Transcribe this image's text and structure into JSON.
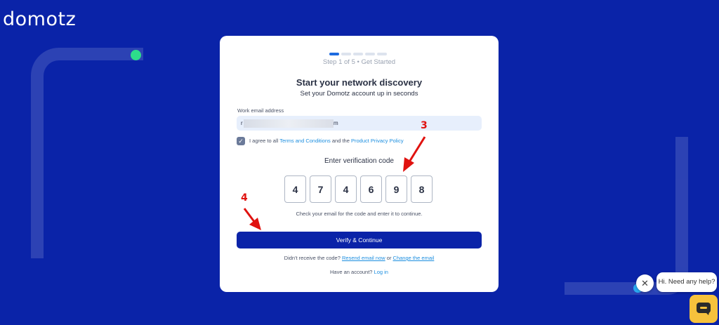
{
  "brand": {
    "logo_text": "domotz"
  },
  "colors": {
    "background": "#0a23a8",
    "primary_button": "#0a23a8",
    "link": "#1d8fe0",
    "annotation": "#e0120f",
    "chat_button": "#f7c23c"
  },
  "progress": {
    "current_step": 1,
    "total_steps": 5,
    "text": "Step 1 of 5 • Get Started"
  },
  "header": {
    "title": "Start your network discovery",
    "subtitle": "Set your Domotz account up in seconds"
  },
  "email": {
    "label": "Work email address",
    "value_prefix": "r",
    "value_suffix": "m"
  },
  "agreement": {
    "checked": true,
    "text_before": "I agree to all ",
    "terms_link": "Terms and Conditions",
    "text_middle": " and the ",
    "privacy_link": "Product Privacy Policy"
  },
  "verification": {
    "label": "Enter verification code",
    "digits": [
      "4",
      "7",
      "4",
      "6",
      "9",
      "8"
    ],
    "hint": "Check your email for the code and enter it to continue."
  },
  "verify_button": {
    "label": "Verify & Continue"
  },
  "resend": {
    "text": "Didn't receive the code? ",
    "resend_link": "Resend email now",
    "or": " or ",
    "change_link": "Change the email"
  },
  "login": {
    "text": "Have an account? ",
    "link": "Log in"
  },
  "annotations": {
    "step3": "3",
    "step4": "4"
  },
  "chat": {
    "bubble_text": "Hi. Need any help?",
    "close_icon": "close-icon",
    "button_icon": "chat-icon"
  }
}
